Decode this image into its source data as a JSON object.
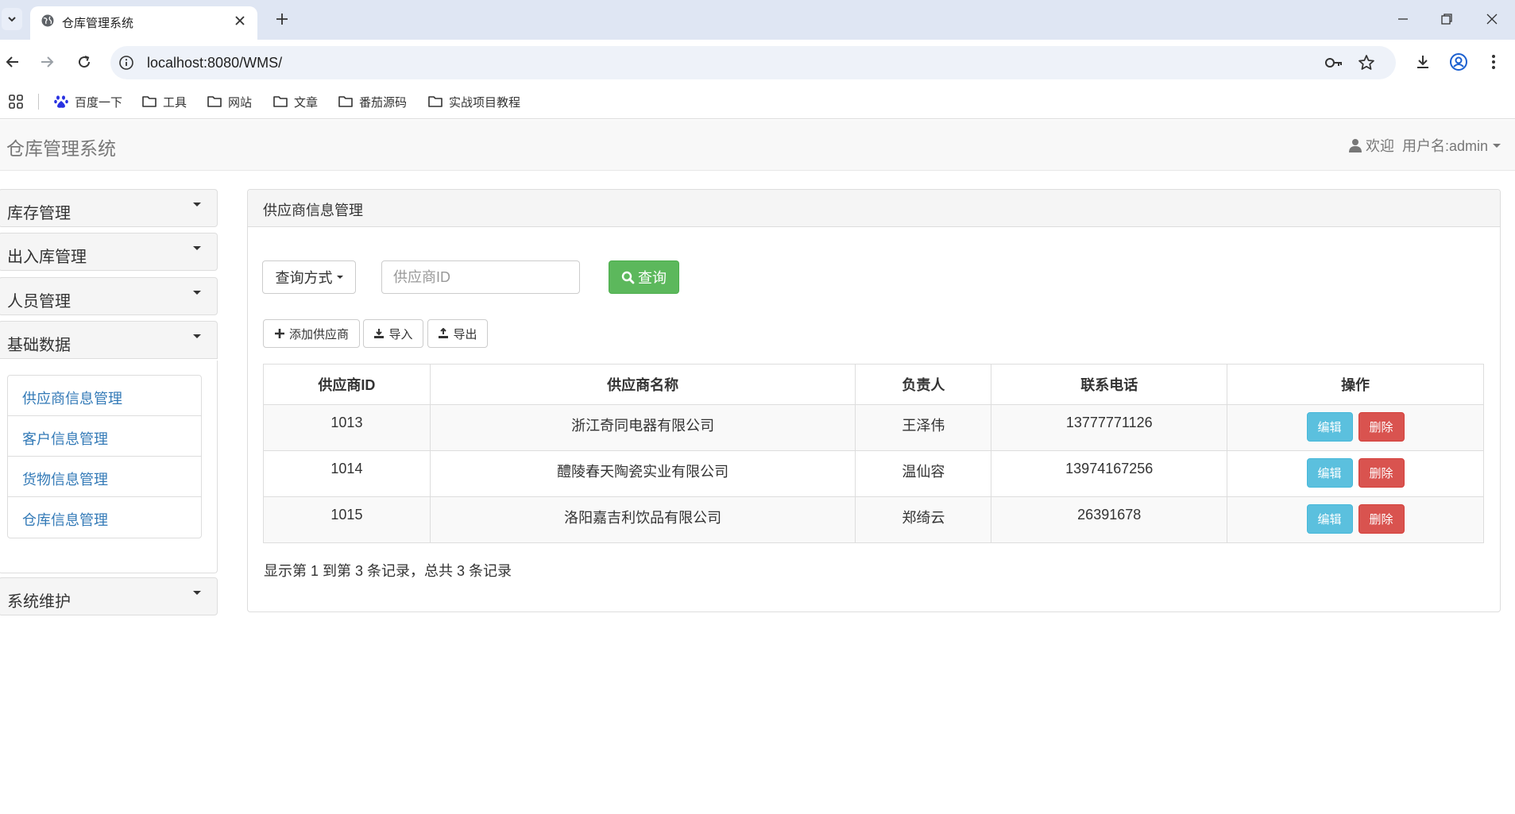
{
  "browser": {
    "tab_title": "仓库管理系统",
    "url": "localhost:8080/WMS/",
    "bookmarks": [
      "百度一下",
      "工具",
      "网站",
      "文章",
      "番茄源码",
      "实战项目教程"
    ]
  },
  "app": {
    "brand": "仓库管理系统",
    "user": {
      "welcome": "欢迎",
      "username": "用户名:admin"
    }
  },
  "sidebar": {
    "sections": [
      {
        "label": "库存管理"
      },
      {
        "label": "出入库管理"
      },
      {
        "label": "人员管理"
      },
      {
        "label": "基础数据"
      },
      {
        "label": "系统维护"
      }
    ],
    "basic_data_items": [
      {
        "label": "供应商信息管理"
      },
      {
        "label": "客户信息管理"
      },
      {
        "label": "货物信息管理"
      },
      {
        "label": "仓库信息管理"
      }
    ]
  },
  "main": {
    "panel_title": "供应商信息管理",
    "query_mode_label": "查询方式",
    "search_placeholder": "供应商ID",
    "search_button": "查询",
    "add_button": "添加供应商",
    "import_button": "导入",
    "export_button": "导出",
    "table": {
      "headers": [
        "供应商ID",
        "供应商名称",
        "负责人",
        "联系电话",
        "操作"
      ],
      "rows": [
        {
          "id": "1013",
          "name": "浙江奇同电器有限公司",
          "person": "王泽伟",
          "phone": "13777771126"
        },
        {
          "id": "1014",
          "name": "醴陵春天陶瓷实业有限公司",
          "person": "温仙容",
          "phone": "13974167256"
        },
        {
          "id": "1015",
          "name": "洛阳嘉吉利饮品有限公司",
          "person": "郑绮云",
          "phone": "26391678"
        }
      ],
      "edit_label": "编辑",
      "delete_label": "删除"
    },
    "pager_info": "显示第 1 到第 3 条记录，总共 3 条记录"
  },
  "colors": {
    "success": "#5cb85c",
    "info": "#5bc0de",
    "danger": "#d9534f",
    "link": "#337ab7"
  }
}
